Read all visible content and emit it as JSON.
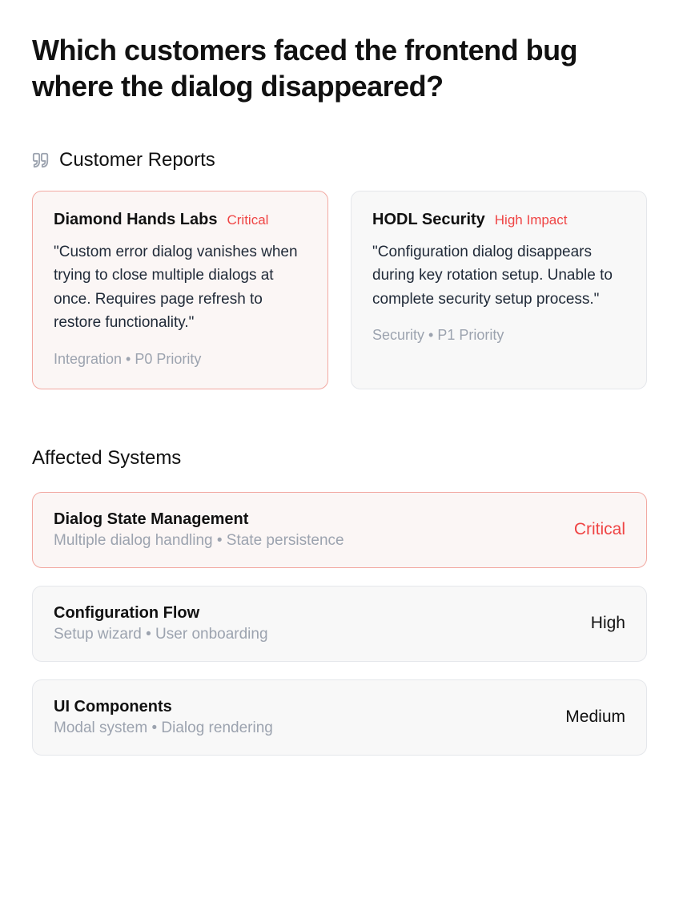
{
  "page_title": "Which customers faced the frontend bug where the dialog disappeared?",
  "reports_section_title": "Customer Reports",
  "reports": [
    {
      "name": "Diamond Hands Labs",
      "badge": "Critical",
      "quote": "\"Custom error dialog vanishes when trying to close multiple dialogs at once. Requires page refresh to restore functionality.\"",
      "meta": "Integration • P0 Priority",
      "severity_class": "critical"
    },
    {
      "name": "HODL Security",
      "badge": "High Impact",
      "quote": "\"Configuration dialog disappears during key rotation setup. Unable to complete security setup process.\"",
      "meta": "Security • P1 Priority",
      "severity_class": "normal"
    }
  ],
  "affected_title": "Affected Systems",
  "systems": [
    {
      "name": "Dialog State Management",
      "sub": "Multiple dialog handling • State persistence",
      "severity": "Critical",
      "severity_class": "critical"
    },
    {
      "name": "Configuration Flow",
      "sub": "Setup wizard • User onboarding",
      "severity": "High",
      "severity_class": "normal"
    },
    {
      "name": "UI Components",
      "sub": "Modal system • Dialog rendering",
      "severity": "Medium",
      "severity_class": "normal"
    }
  ]
}
